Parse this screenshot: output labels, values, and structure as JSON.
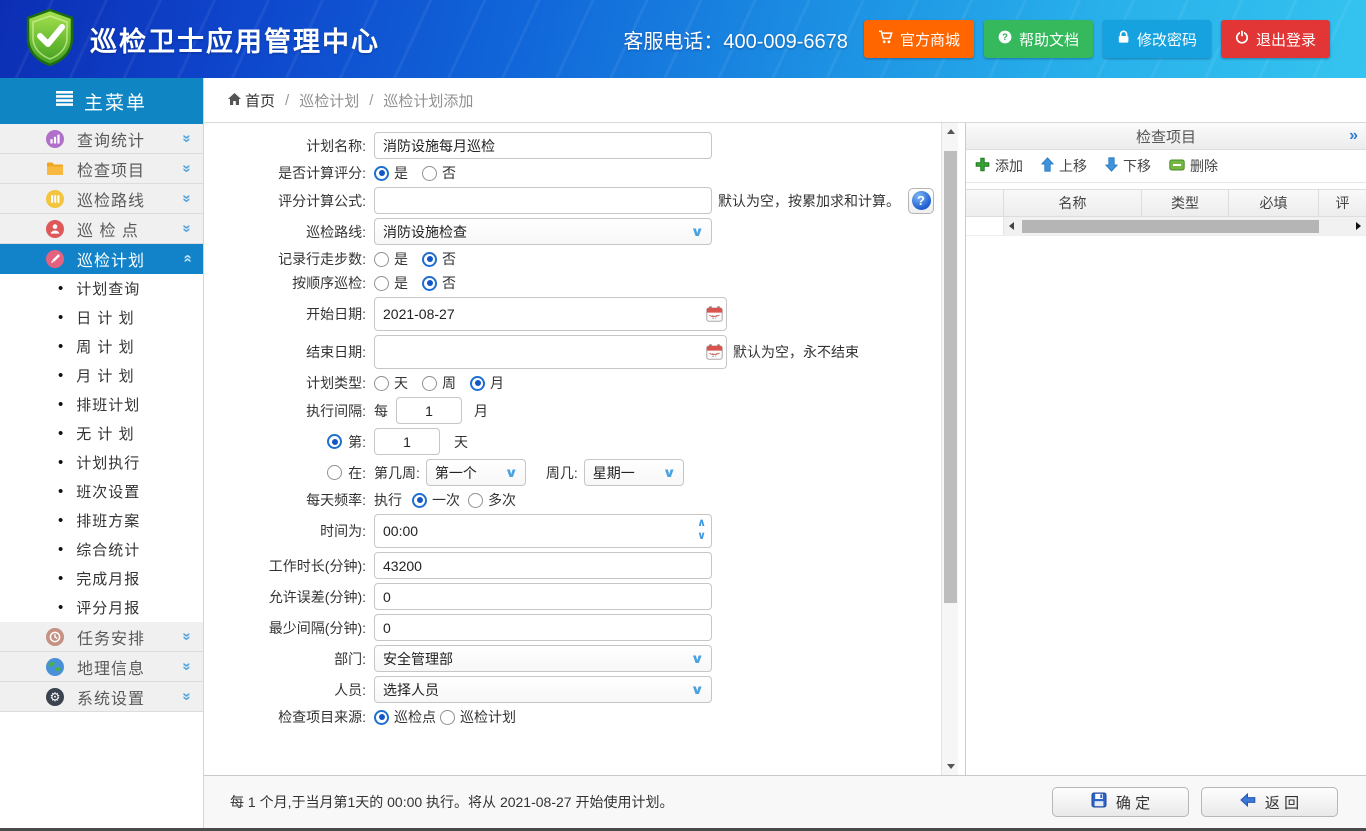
{
  "header": {
    "title": "巡检卫士应用管理中心",
    "service_phone_label": "客服电话：",
    "service_phone": "400-009-6678",
    "buttons": [
      {
        "label": "官方商城",
        "icon": "cart-icon",
        "color": "#ff6600"
      },
      {
        "label": "帮助文档",
        "icon": "question-icon",
        "color": "#35b95c"
      },
      {
        "label": "修改密码",
        "icon": "lock-icon",
        "color": "#15a2df"
      },
      {
        "label": "退出登录",
        "icon": "power-icon",
        "color": "#e23636"
      }
    ]
  },
  "sidebar": {
    "menu_title": "主菜单",
    "items": [
      {
        "label": "查询统计",
        "icon": "stats-icon",
        "color": "#b06fc9",
        "active": false
      },
      {
        "label": "检查项目",
        "icon": "folder-icon",
        "color": "#f2a51e",
        "active": false
      },
      {
        "label": "巡检路线",
        "icon": "route-icon",
        "color": "#f2c53d",
        "active": false
      },
      {
        "label": "巡 检 点",
        "icon": "point-icon",
        "color": "#e0575a",
        "active": false
      },
      {
        "label": "巡检计划",
        "icon": "plan-icon",
        "color": "#e4627f",
        "active": true
      },
      {
        "label": "任务安排",
        "icon": "task-icon",
        "color": "#c49182",
        "active": false
      },
      {
        "label": "地理信息",
        "icon": "globe-icon",
        "color": "#4a90d9",
        "active": false
      },
      {
        "label": "系统设置",
        "icon": "gear-icon",
        "color": "#3c4350",
        "active": false
      }
    ],
    "submenu": [
      "计划查询",
      "日 计 划",
      "周 计 划",
      "月 计 划",
      "排班计划",
      "无 计 划",
      "计划执行",
      "班次设置",
      "排班方案",
      "综合统计",
      "完成月报",
      "评分月报"
    ]
  },
  "breadcrumb": {
    "home": "首页",
    "separator": "/",
    "items": [
      "巡检计划",
      "巡检计划添加"
    ]
  },
  "form": {
    "plan_name": {
      "label": "计划名称:",
      "value": "消防设施每月巡检"
    },
    "calc_score": {
      "label": "是否计算评分:",
      "options": [
        "是",
        "否"
      ],
      "selected": "是"
    },
    "score_formula": {
      "label": "评分计算公式:",
      "value": "",
      "hint": "默认为空，按累加求和计算。"
    },
    "route": {
      "label": "巡检路线:",
      "value": "消防设施检查"
    },
    "record_steps": {
      "label": "记录行走步数:",
      "options": [
        "是",
        "否"
      ],
      "selected": "否"
    },
    "in_order": {
      "label": "按顺序巡检:",
      "options": [
        "是",
        "否"
      ],
      "selected": "否"
    },
    "start_date": {
      "label": "开始日期:",
      "value": "2021-08-27"
    },
    "end_date": {
      "label": "结束日期:",
      "value": "",
      "hint": "默认为空，永不结束"
    },
    "plan_type": {
      "label": "计划类型:",
      "options": [
        "天",
        "周",
        "月"
      ],
      "selected": "月"
    },
    "interval": {
      "label": "执行间隔:",
      "prefix": "每",
      "value": "1",
      "suffix": "月"
    },
    "day_option": {
      "label": "第:",
      "value": "1",
      "suffix": "天",
      "selected": true
    },
    "week_option": {
      "label": "在:",
      "week_label": "第几周:",
      "week_value": "第一个",
      "weekday_label": "周几:",
      "weekday_value": "星期一",
      "selected": false
    },
    "daily_freq": {
      "label": "每天频率:",
      "prefix": "执行",
      "options": [
        "一次",
        "多次"
      ],
      "selected": "一次"
    },
    "time": {
      "label": "时间为:",
      "value": "00:00"
    },
    "work_duration": {
      "label": "工作时长(分钟):",
      "value": "43200"
    },
    "allow_error": {
      "label": "允许误差(分钟):",
      "value": "0"
    },
    "min_interval": {
      "label": "最少间隔(分钟):",
      "value": "0"
    },
    "department": {
      "label": "部门:",
      "value": "安全管理部"
    },
    "personnel": {
      "label": "人员:",
      "value": "选择人员"
    },
    "item_source": {
      "label": "检查项目来源:",
      "options": [
        "巡检点",
        "巡检计划"
      ],
      "selected": "巡检点"
    }
  },
  "right_panel": {
    "title": "检查项目",
    "collapse_icon": "»",
    "toolbar": [
      {
        "label": "添加",
        "icon": "add-icon"
      },
      {
        "label": "上移",
        "icon": "move-up-icon"
      },
      {
        "label": "下移",
        "icon": "move-down-icon"
      },
      {
        "label": "删除",
        "icon": "delete-icon"
      }
    ],
    "columns": [
      "",
      "名称",
      "类型",
      "必填",
      "评"
    ]
  },
  "footer": {
    "summary": "每 1 个月,于当月第1天的 00:00 执行。将从 2021-08-27 开始使用计划。",
    "confirm_label": "确 定",
    "back_label": "返 回"
  }
}
